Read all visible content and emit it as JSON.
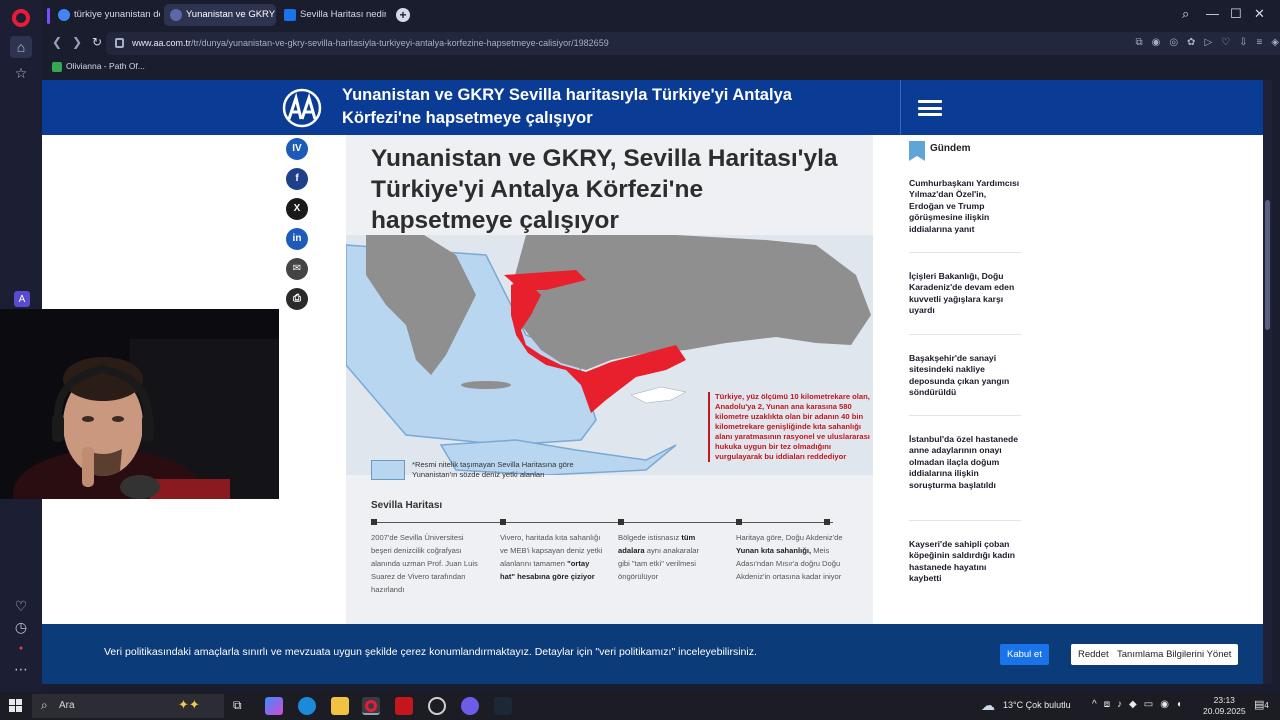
{
  "browser": {
    "tabs": [
      {
        "label": "türkiye yunanistan deniz s",
        "favicon_color": "#4285f4"
      },
      {
        "label": "Yunanistan ve GKRY Sevill",
        "favicon_color": "#5a6aa6"
      },
      {
        "label": "Sevilla Haritası nedir? Ank",
        "favicon_color": "#1a73e8"
      }
    ],
    "url_domain": "www.aa.com.tr",
    "url_path": "/tr/dunya/yunanistan-ve-gkry-sevilla-haritasiyla-turkiyeyi-antalya-korfezine-hapsetmeye-calisiyor/1982659",
    "bookmark": "Olivianna - Path Of..."
  },
  "header": {
    "title": "Yunanistan ve GKRY Sevilla haritasıyla Türkiye'yi Antalya Körfezi'ne hapsetmeye çalışıyor"
  },
  "share": {
    "items": [
      {
        "glyph": "IV",
        "color": "#1e5bb8"
      },
      {
        "glyph": "f",
        "color": "#1e3f8a"
      },
      {
        "glyph": "X",
        "color": "#1a1a1a"
      },
      {
        "glyph": "in",
        "color": "#1e5bb8"
      },
      {
        "glyph": "✉",
        "color": "#444"
      },
      {
        "glyph": "⎙",
        "color": "#2a2a2a"
      }
    ]
  },
  "infographic": {
    "title": "Yunanistan ve GKRY, Sevilla Haritası'yla Türkiye'yi Antalya Körfezi'ne hapsetmeye çalışıyor",
    "red_note": "Türkiye, yüz ölçümü 10 kilometrekare olan, Anadolu'ya 2, Yunan ana karasına 580 kilometre uzaklıkta olan bir adanın 40 bin kilometrekare genişliğinde kıta sahanlığı alanı yaratmasının rasyonel ve uluslararası hukuka uygun bir tez olmadığını vurgulayarak bu iddiaları reddediyor",
    "legend": "*Resmi nitelik taşımayan Sevilla Haritasına göre Yunanistan'ın sözde deniz yetki alanları",
    "section_title": "Sevilla Haritası",
    "timeline": [
      {
        "pre": "2007'de Sevilla Üniversitesi beşeri denizcilik coğrafyası alanında uzman Prof. Juan Luis Suarez de Vivero tarafından hazırlandı",
        "bold": "",
        "post": ""
      },
      {
        "pre": "Vivero, haritada kıta sahanlığı ve MEB'i kapsayan deniz yetki alanlarını tamamen ",
        "bold": "\"ortay hat\" hesabına göre çiziyor",
        "post": ""
      },
      {
        "pre": "Bölgede istisnasız ",
        "bold": "tüm adalara",
        "post": " aynı anakaralar gibi \"tam etki\" verilmesi öngörülüyor"
      },
      {
        "pre": "Haritaya göre, Doğu Akdeniz'de ",
        "bold": "Yunan kıta sahanlığı,",
        "post": " Meis Adası'ndan Mısır'a doğru Doğu Akdeniz'in ortasına kadar iniyor"
      }
    ]
  },
  "sidebar_news": {
    "heading": "Gündem",
    "items": [
      "Cumhurbaşkanı Yardımcısı Yılmaz'dan Özel'in, Erdoğan ve Trump görüşmesine ilişkin iddialarına yanıt",
      "İçişleri Bakanlığı, Doğu Karadeniz'de devam eden kuvvetli yağışlara karşı uyardı",
      "Başakşehir'de sanayi sitesindeki nakliye deposunda çıkan yangın söndürüldü",
      "İstanbul'da özel hastanede anne adaylarının onayı olmadan ilaçla doğum iddialarına ilişkin soruşturma başlatıldı",
      "Kayseri'de sahipli çoban köpeğinin saldırdığı kadın hastanede hayatını kaybetti"
    ]
  },
  "cookie": {
    "text": "Veri politikasındaki amaçlarla sınırlı ve mevzuata uygun şekilde çerez konumlandırmaktayız. Detaylar için \"veri politikamızı\" inceleyebilirsiniz.",
    "accept": "Kabul et",
    "reject": "Reddet",
    "manage": "Tanımlama Bilgilerini Yönet"
  },
  "taskbar": {
    "search_placeholder": "Ara",
    "weather": "13°C  Çok bulutlu",
    "time": "23:13",
    "date": "20.09.2025",
    "notifications": "4"
  },
  "colors": {
    "aa_blue": "#0b3c95",
    "map_red": "#e8202e",
    "map_land": "#8f8f8f",
    "sea_claim": "#b8d6ef",
    "accept_btn": "#1a73e8"
  }
}
